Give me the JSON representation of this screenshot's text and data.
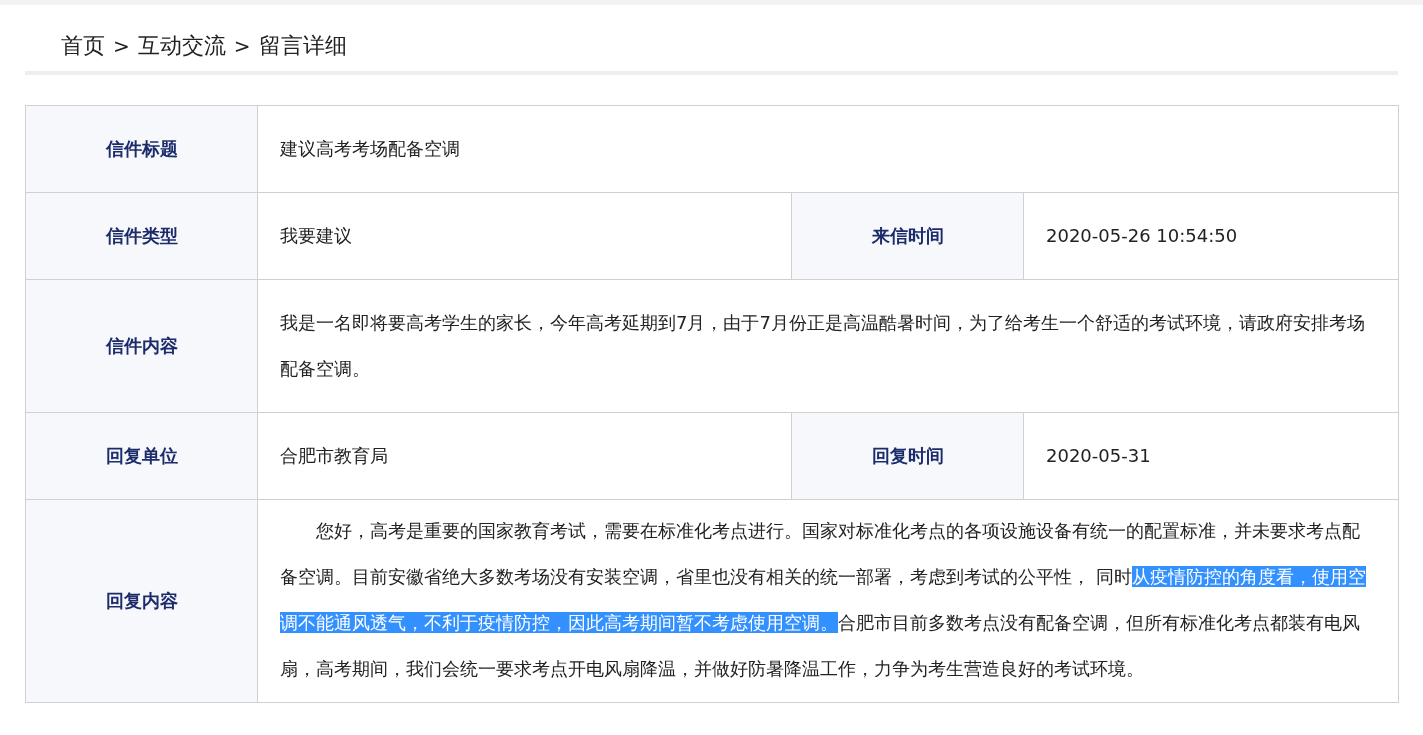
{
  "breadcrumb": [
    {
      "kind": "link",
      "text": "首页"
    },
    {
      "kind": "separator",
      "text": ">"
    },
    {
      "kind": "link",
      "text": "互动交流"
    },
    {
      "kind": "separator",
      "text": ">"
    },
    {
      "kind": "current",
      "text": "留言详细"
    }
  ],
  "rows": [
    {
      "fields": [
        {
          "label": "信件标题",
          "value": "建议高考考场配备空调"
        }
      ]
    },
    {
      "fields": [
        {
          "label": "信件类型",
          "value": "我要建议"
        },
        {
          "label": "来信时间",
          "value": "2020-05-26 10:54:50"
        }
      ]
    },
    {
      "fields": [
        {
          "label": "信件内容",
          "value": "我是一名即将要高考学生的家长，今年高考延期到7月，由于7月份正是高温酷暑时间，为了给考生一个舒适的考试环境，请政府安排考场配备空调。"
        }
      ]
    },
    {
      "fields": [
        {
          "label": "回复单位",
          "value": "合肥市教育局"
        },
        {
          "label": "回复时间",
          "value": "2020-05-31"
        }
      ]
    },
    {
      "fields": [
        {
          "label": "回复内容",
          "segments": [
            {
              "text": "您好，高考是重要的国家教育考试，需要在标准化考点进行。国家对标准化考点的各项设施设备有统一的配置标准，并未要求考点配备空调。目前安徽省绝大多数考场没有安装空调，省里也没有相关的统一部署，考虑到考试的公平性， 同时",
              "selected": false
            },
            {
              "text": "从疫情防控的角度看，使用空调不能通风透气，不利于疫情防控，因此高考期间暂不考虑使用空调。",
              "selected": true
            },
            {
              "text": "合肥市目前多数考点没有配备空调，但所有标准化考点都装有电风扇，高考期间，我们会统一要求考点开电风扇降温，并做好防暑降温工作，力争为考生营造良好的考试环境。",
              "selected": false
            }
          ]
        }
      ]
    }
  ]
}
